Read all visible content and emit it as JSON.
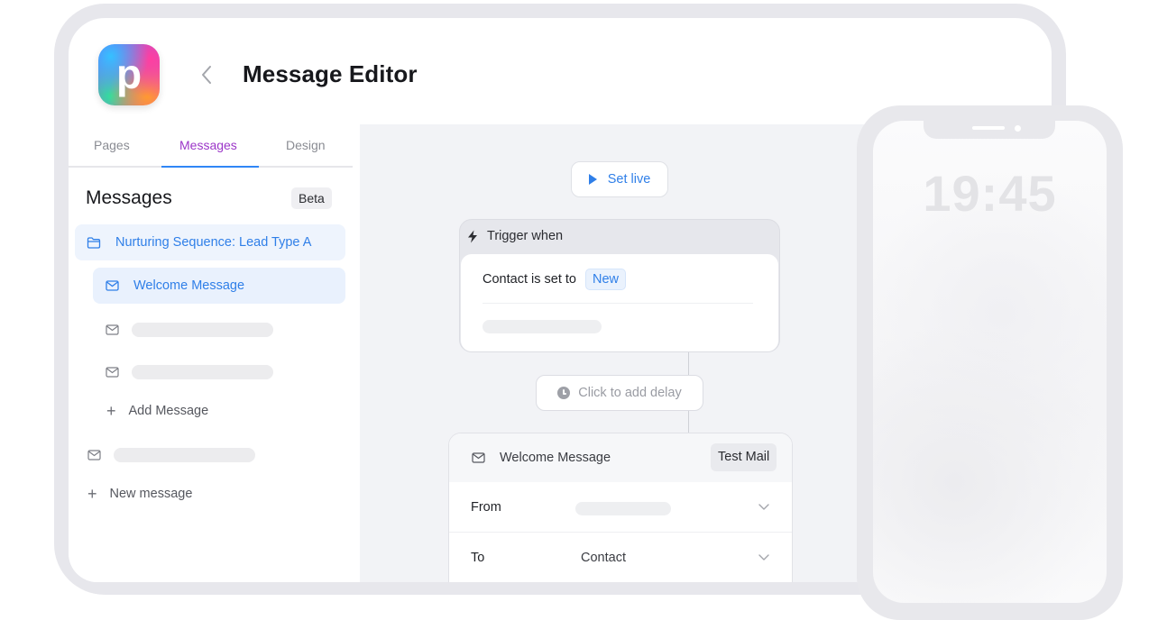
{
  "header": {
    "logo_letter": "p",
    "title": "Message Editor"
  },
  "sidebar": {
    "tabs": [
      {
        "label": "Pages"
      },
      {
        "label": "Messages",
        "active": true
      },
      {
        "label": "Design"
      }
    ],
    "heading": "Messages",
    "badge": "Beta",
    "sequence_label": "Nurturing Sequence: Lead Type A",
    "selected_message": "Welcome Message",
    "add_message_label": "Add Message",
    "new_message_label": "New message"
  },
  "canvas": {
    "set_live_label": "Set live",
    "trigger": {
      "title": "Trigger when",
      "condition_text": "Contact is set to",
      "condition_value": "New"
    },
    "delay_label": "Click to add delay",
    "message_card": {
      "name": "Welcome Message",
      "test_button": "Test Mail",
      "fields": [
        {
          "label": "From",
          "value": ""
        },
        {
          "label": "To",
          "value": "Contact"
        }
      ]
    }
  },
  "phone": {
    "time": "19:45"
  },
  "colors": {
    "accent_blue": "#2f7fe8",
    "tab_active": "#9b35c8",
    "selected_bg": "#e9f1fd"
  },
  "icons": [
    "chevron-left-icon",
    "folder-icon",
    "envelope-icon",
    "plus-icon",
    "play-icon",
    "lightning-icon",
    "clock-icon",
    "chevron-down-icon"
  ]
}
